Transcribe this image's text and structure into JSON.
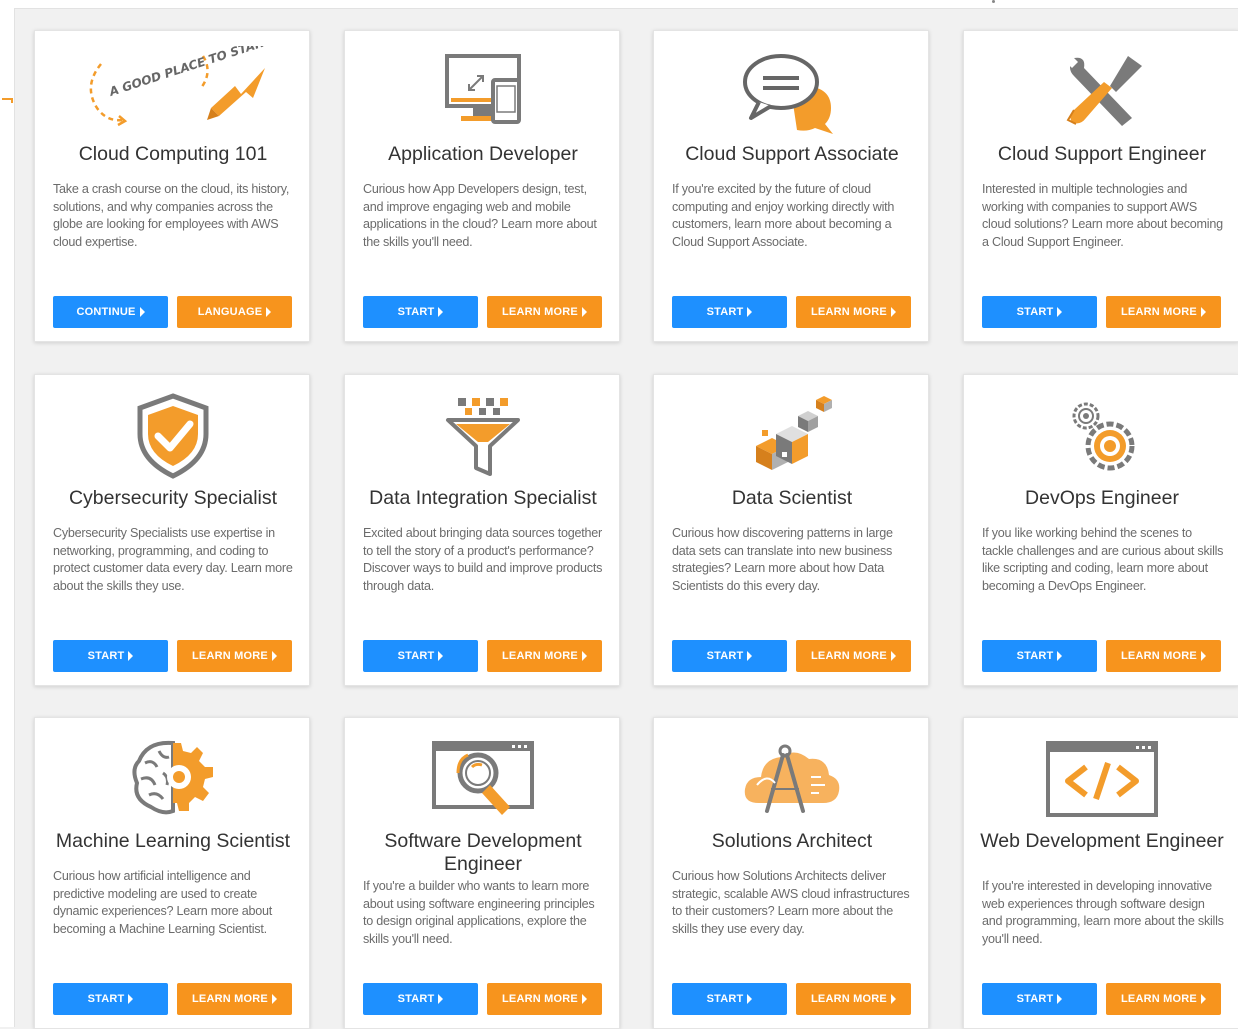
{
  "colors": {
    "primary_button": "#1e90ff",
    "secondary_button": "#f7941d",
    "icon_orange": "#f39c2b",
    "icon_gray": "#7a7a7a"
  },
  "cards": [
    {
      "title": "Cloud Computing 101",
      "icon": "good-place-to-start-icon",
      "icon_text": "A GOOD PLACE TO START!",
      "description": "Take a crash course on the cloud, its history, solutions, and why companies across the globe are looking for employees with AWS cloud expertise.",
      "primary_label": "CONTINUE",
      "secondary_label": "LANGUAGE"
    },
    {
      "title": "Application Developer",
      "icon": "devices-icon",
      "description": "Curious how App Developers design, test, and improve engaging web and mobile applications in the cloud? Learn more about the skills you'll need.",
      "primary_label": "START",
      "secondary_label": "LEARN MORE"
    },
    {
      "title": "Cloud Support Associate",
      "icon": "chat-bubbles-icon",
      "description": "If you're excited by the future of cloud computing and enjoy working directly with customers, learn more about becoming a Cloud Support Associate.",
      "primary_label": "START",
      "secondary_label": "LEARN MORE"
    },
    {
      "title": "Cloud Support Engineer",
      "icon": "tools-icon",
      "description": "Interested in multiple technologies and working with companies to support AWS cloud solutions? Learn more about becoming a Cloud Support Engineer.",
      "primary_label": "START",
      "secondary_label": "LEARN MORE"
    },
    {
      "title": "Cybersecurity Specialist",
      "icon": "shield-check-icon",
      "description": "Cybersecurity Specialists use expertise in networking, programming, and coding to protect customer data every day. Learn more about the skills they use.",
      "primary_label": "START",
      "secondary_label": "LEARN MORE"
    },
    {
      "title": "Data Integration Specialist",
      "icon": "funnel-icon",
      "description": "Excited about bringing data sources together to tell the story of a product's performance? Discover ways to build and improve products through data.",
      "primary_label": "START",
      "secondary_label": "LEARN MORE"
    },
    {
      "title": "Data Scientist",
      "icon": "data-cubes-icon",
      "description": "Curious how discovering patterns in large data sets can translate into new business strategies? Learn more about how Data Scientists do this every day.",
      "primary_label": "START",
      "secondary_label": "LEARN MORE"
    },
    {
      "title": "DevOps Engineer",
      "icon": "gears-icon",
      "description": "If you like working behind the scenes to tackle challenges and are curious about skills like scripting and coding, learn more about becoming a DevOps Engineer.",
      "primary_label": "START",
      "secondary_label": "LEARN MORE"
    },
    {
      "title": "Machine Learning Scientist",
      "icon": "brain-gear-icon",
      "description": "Curious how artificial intelligence and predictive modeling are used to create dynamic experiences? Learn more about becoming a Machine Learning Scientist.",
      "primary_label": "START",
      "secondary_label": "LEARN MORE"
    },
    {
      "title": "Software Development Engineer",
      "icon": "browser-magnifier-icon",
      "description": "If you're a builder who wants to learn more about using software engineering principles to design original applications, explore the skills you'll need.",
      "primary_label": "START",
      "secondary_label": "LEARN MORE"
    },
    {
      "title": "Solutions Architect",
      "icon": "cloud-compass-icon",
      "description": "Curious how Solutions Architects deliver strategic, scalable AWS cloud infrastructures to their customers? Learn more about the skills they use every day.",
      "primary_label": "START",
      "secondary_label": "LEARN MORE"
    },
    {
      "title": "Web Development Engineer",
      "icon": "code-window-icon",
      "description": "If you're interested in developing innovative web experiences through software design and programming, learn more about the skills you'll need.",
      "primary_label": "START",
      "secondary_label": "LEARN MORE"
    }
  ]
}
